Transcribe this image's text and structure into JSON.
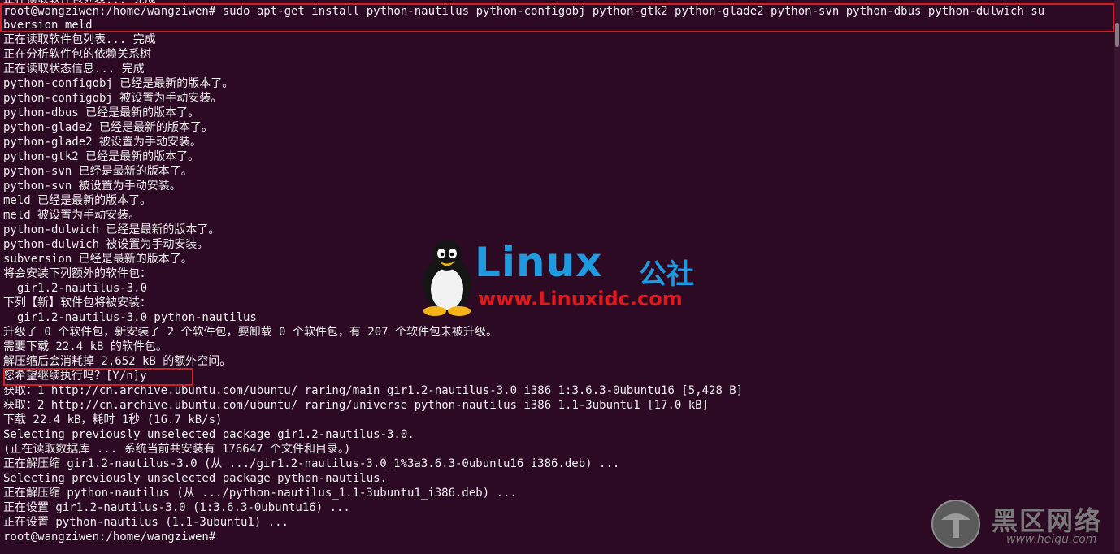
{
  "terminal": {
    "lines": [
      "正在读取软件包列表... 完成",
      "root@wangziwen:/home/wangziwen# sudo apt-get install python-nautilus python-configobj python-gtk2 python-glade2 python-svn python-dbus python-dulwich su",
      "bversion meld",
      "正在读取软件包列表... 完成",
      "正在分析软件包的依赖关系树",
      "正在读取状态信息... 完成",
      "python-configobj 已经是最新的版本了。",
      "python-configobj 被设置为手动安装。",
      "python-dbus 已经是最新的版本了。",
      "python-glade2 已经是最新的版本了。",
      "python-glade2 被设置为手动安装。",
      "python-gtk2 已经是最新的版本了。",
      "python-svn 已经是最新的版本了。",
      "python-svn 被设置为手动安装。",
      "meld 已经是最新的版本了。",
      "meld 被设置为手动安装。",
      "python-dulwich 已经是最新的版本了。",
      "python-dulwich 被设置为手动安装。",
      "subversion 已经是最新的版本了。",
      "将会安装下列额外的软件包：",
      "  gir1.2-nautilus-3.0",
      "下列【新】软件包将被安装：",
      "  gir1.2-nautilus-3.0 python-nautilus",
      "升级了 0 个软件包，新安装了 2 个软件包，要卸载 0 个软件包，有 207 个软件包未被升级。",
      "需要下载 22.4 kB 的软件包。",
      "解压缩后会消耗掉 2,652 kB 的额外空间。",
      "您希望继续执行吗？[Y/n]y",
      "获取：1 http://cn.archive.ubuntu.com/ubuntu/ raring/main gir1.2-nautilus-3.0 i386 1:3.6.3-0ubuntu16 [5,428 B]",
      "获取：2 http://cn.archive.ubuntu.com/ubuntu/ raring/universe python-nautilus i386 1.1-3ubuntu1 [17.0 kB]",
      "下载 22.4 kB，耗时 1秒 (16.7 kB/s)",
      "Selecting previously unselected package gir1.2-nautilus-3.0.",
      "(正在读取数据库 ... 系统当前共安装有 176647 个文件和目录。)",
      "正在解压缩 gir1.2-nautilus-3.0 (从 .../gir1.2-nautilus-3.0_1%3a3.6.3-0ubuntu16_i386.deb) ...",
      "Selecting previously unselected package python-nautilus.",
      "正在解压缩 python-nautilus (从 .../python-nautilus_1.1-3ubuntu1_i386.deb) ...",
      "正在设置 gir1.2-nautilus-3.0 (1:3.6.3-0ubuntu16) ...",
      "正在设置 python-nautilus (1.1-3ubuntu1) ...",
      "root@wangziwen:/home/wangziwen# "
    ]
  },
  "watermarks": {
    "linux_brand": "Linux",
    "linux_suffix": "公社",
    "linux_url": "www.Linuxidc.com",
    "heiqu_brand": "黑区网络",
    "heiqu_url": "www.heiqu.com"
  },
  "colors": {
    "background": "#2c0a24",
    "text": "#efefef",
    "highlight_border": "#d31f1f",
    "linux_blue": "#1d9ae0",
    "linux_url_red": "#e0191f"
  }
}
